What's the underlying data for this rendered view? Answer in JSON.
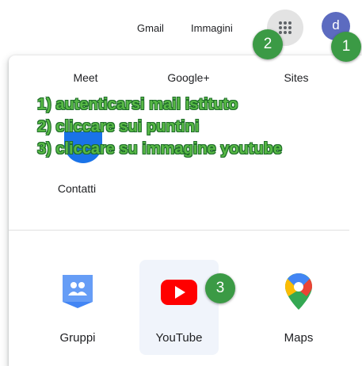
{
  "header": {
    "gmail": "Gmail",
    "images": "Immagini",
    "avatar_initial": "d",
    "apps_icon": "apps-grid-icon"
  },
  "badges": [
    "1",
    "2",
    "3"
  ],
  "apps_panel": {
    "row1": [
      "Meet",
      "Google+",
      "Sites"
    ],
    "contacts": "Contatti",
    "bottom_apps": [
      {
        "label": "Gruppi",
        "icon": "groups-icon"
      },
      {
        "label": "YouTube",
        "icon": "youtube-icon"
      },
      {
        "label": "Maps",
        "icon": "maps-pin-icon"
      }
    ]
  },
  "instructions": [
    "1) autenticarsi mail istituto",
    "2) cliccare sui puntini",
    "3) cliccare su immagine youtube"
  ],
  "colors": {
    "annotation_green": "#3b9a45",
    "avatar": "#5c6bc0",
    "youtube_red": "#ff0000"
  }
}
